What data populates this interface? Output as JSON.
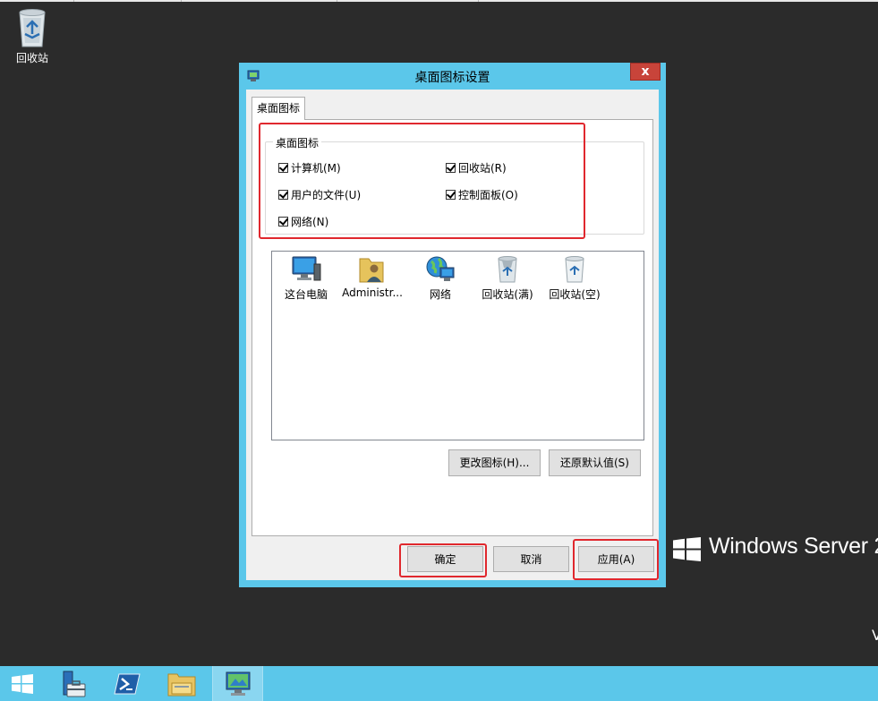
{
  "desktop": {
    "recycle_bin_label": "回收站",
    "brand_text": "Windows Server 2",
    "corner_letter": "V"
  },
  "dialog": {
    "title": "桌面图标设置",
    "close_label": "x",
    "tab_label": "桌面图标",
    "group_title": "桌面图标",
    "checkboxes": [
      {
        "label": "计算机(M)",
        "checked": true
      },
      {
        "label": "回收站(R)",
        "checked": true
      },
      {
        "label": "用户的文件(U)",
        "checked": true
      },
      {
        "label": "控制面板(O)",
        "checked": true
      },
      {
        "label": "网络(N)",
        "checked": true
      }
    ],
    "icon_list": [
      {
        "label": "这台电脑",
        "icon": "monitor-icon"
      },
      {
        "label": "Administr...",
        "icon": "user-folder-icon"
      },
      {
        "label": "网络",
        "icon": "network-globe-icon"
      },
      {
        "label": "回收站(满)",
        "icon": "recycle-bin-full-icon"
      },
      {
        "label": "回收站(空)",
        "icon": "recycle-bin-empty-icon"
      }
    ],
    "change_icon_label": "更改图标(H)...",
    "restore_default_label": "还原默认值(S)",
    "ok_label": "确定",
    "cancel_label": "取消",
    "apply_label": "应用(A)"
  },
  "taskbar": {
    "items": [
      "start-icon",
      "server-manager-icon",
      "powershell-icon",
      "file-explorer-icon",
      "desktop-icon-settings-icon"
    ]
  },
  "colors": {
    "accent": "#5bc7ea",
    "desktop_bg": "#2b2b2b",
    "highlight_red": "#e0282e",
    "close_red": "#c8443a"
  }
}
